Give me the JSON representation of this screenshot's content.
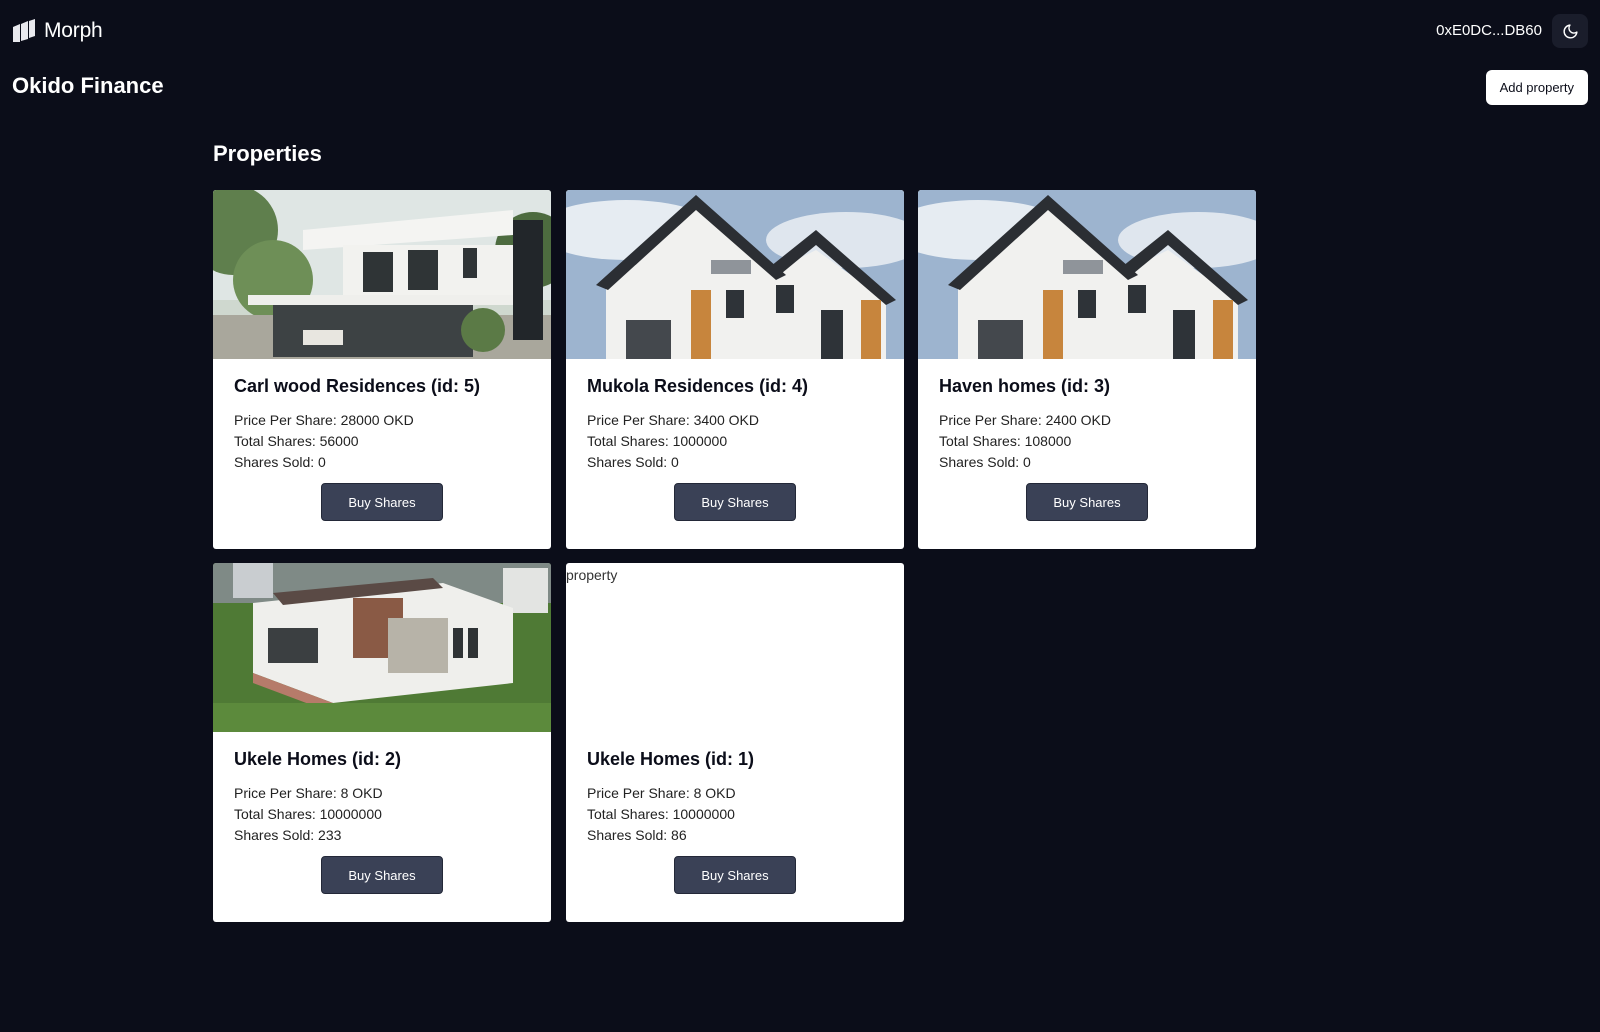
{
  "header": {
    "brand": "Morph",
    "wallet_address": "0xE0DC...DB60",
    "theme_toggle_icon": "moon-icon"
  },
  "app": {
    "title": "Okido Finance",
    "add_property_label": "Add property"
  },
  "properties_section": {
    "title": "Properties",
    "cards": [
      {
        "title": "Carl wood Residences (id: 5)",
        "price_per_share": "Price Per Share: 28000 OKD",
        "total_shares": "Total Shares: 56000",
        "shares_sold": "Shares Sold: 0",
        "buy_label": "Buy Shares"
      },
      {
        "title": "Mukola Residences (id: 4)",
        "price_per_share": "Price Per Share: 3400 OKD",
        "total_shares": "Total Shares: 1000000",
        "shares_sold": "Shares Sold: 0",
        "buy_label": "Buy Shares"
      },
      {
        "title": "Haven homes (id: 3)",
        "price_per_share": "Price Per Share: 2400 OKD",
        "total_shares": "Total Shares: 108000",
        "shares_sold": "Shares Sold: 0",
        "buy_label": "Buy Shares"
      },
      {
        "title": "Ukele Homes (id: 2)",
        "price_per_share": "Price Per Share: 8 OKD",
        "total_shares": "Total Shares: 10000000",
        "shares_sold": "Shares Sold: 233",
        "buy_label": "Buy Shares"
      },
      {
        "title": "Ukele Homes (id: 1)",
        "price_per_share": "Price Per Share: 8 OKD",
        "total_shares": "Total Shares: 10000000",
        "shares_sold": "Shares Sold: 86",
        "buy_label": "Buy Shares",
        "image_alt": "property"
      }
    ]
  }
}
